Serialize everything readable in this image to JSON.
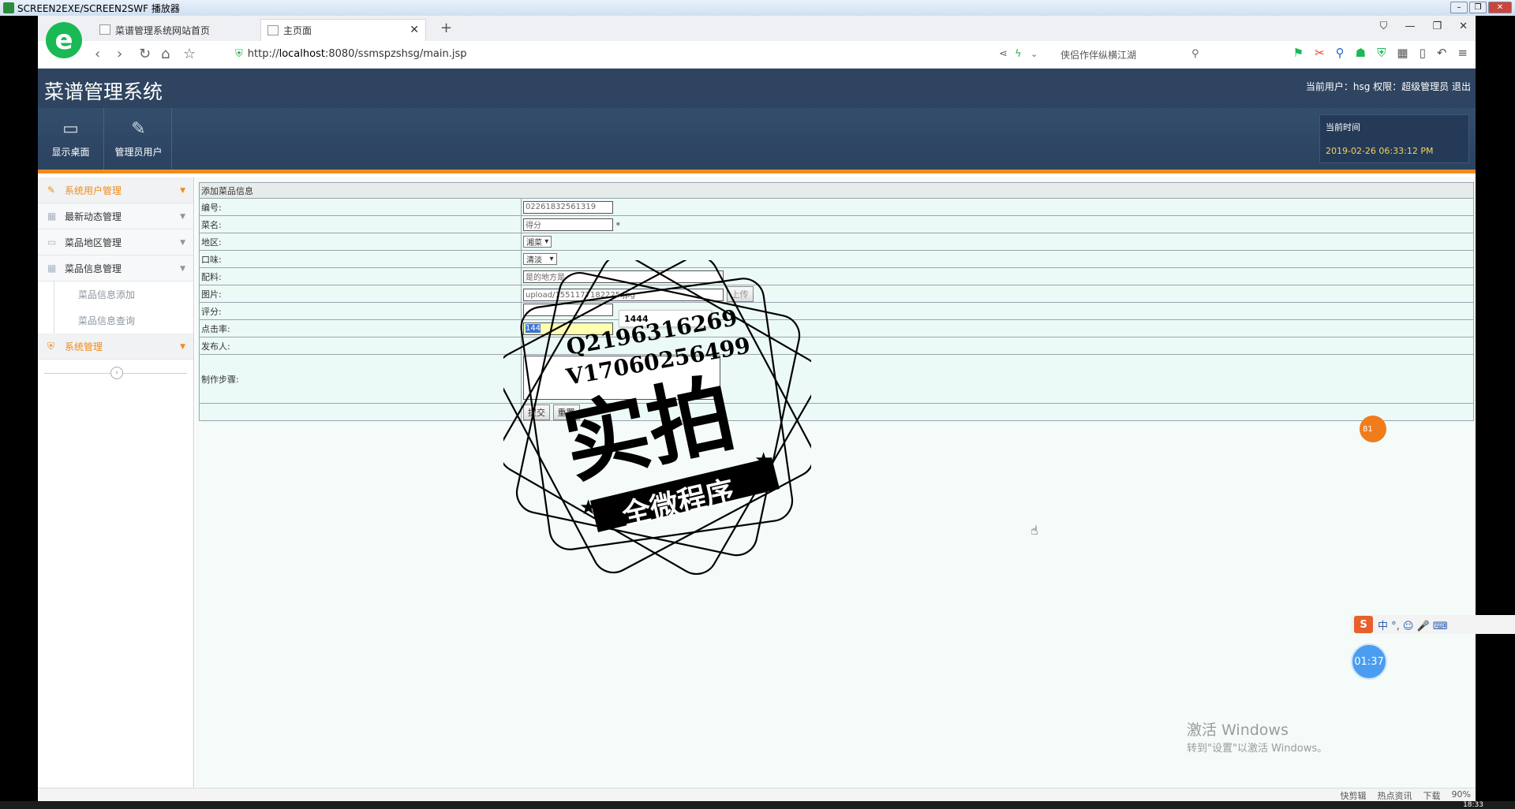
{
  "player": {
    "title": "SCREEN2EXE/SCREEN2SWF 播放器"
  },
  "browser": {
    "tabs": [
      {
        "label": "菜谱管理系统网站首页"
      },
      {
        "label": "主页面"
      }
    ],
    "url_prefix": "http://",
    "url_host": "localhost",
    "url_rest": ":8080/ssmspzshsg/main.jsp",
    "search_text": "侠侣作伴纵横江湖"
  },
  "header": {
    "title": "菜谱管理系统",
    "user_info": "当前用户：hsg  权限：超级管理员  退出"
  },
  "toolbar": {
    "desktop_label": "显示桌面",
    "admin_label": "管理员用户"
  },
  "clock": {
    "label": "当前时间",
    "time": "2019-02-26 06:33:12 PM"
  },
  "sidebar": {
    "items": [
      {
        "label": "系统用户管理"
      },
      {
        "label": "最新动态管理"
      },
      {
        "label": "菜品地区管理"
      },
      {
        "label": "菜品信息管理"
      }
    ],
    "subitems": [
      {
        "label": "菜品信息添加"
      },
      {
        "label": "菜品信息查询"
      }
    ],
    "system_label": "系统管理"
  },
  "form": {
    "caption": "添加菜品信息",
    "labels": {
      "id": "编号:",
      "name": "菜名:",
      "region": "地区:",
      "taste": "口味:",
      "ingredients": "配料:",
      "image": "图片:",
      "score": "评分:",
      "clicks": "点击率:",
      "publisher": "发布人:",
      "steps": "制作步骤:"
    },
    "values": {
      "id": "02261832561319",
      "name": "得分",
      "required_mark": "*",
      "region": "湘菜",
      "taste": "清淡",
      "ingredients": "是的地方是",
      "image": "upload/1551177182225.jpg",
      "clicks_selected": "144"
    },
    "upload_button": "上传",
    "submit_button": "提交",
    "reset_button": "重置",
    "autocomplete_option": "1444"
  },
  "watermark": {
    "line1": "Q2196316269",
    "line2": "V17060256499",
    "big": "实拍",
    "ribbon": "全微程序"
  },
  "activate": {
    "title": "激活 Windows",
    "subtitle": "转到\"设置\"以激活 Windows。"
  },
  "sogou": {
    "text": "中 °, ☺ 🎤 ⌨"
  },
  "timer": {
    "value": "01:37"
  },
  "bubble": {
    "value": "81"
  },
  "statusbar": {
    "items": [
      "快剪辑",
      "热点资讯",
      "下载",
      "90%"
    ]
  },
  "taskbar": {
    "time": "18:33"
  }
}
